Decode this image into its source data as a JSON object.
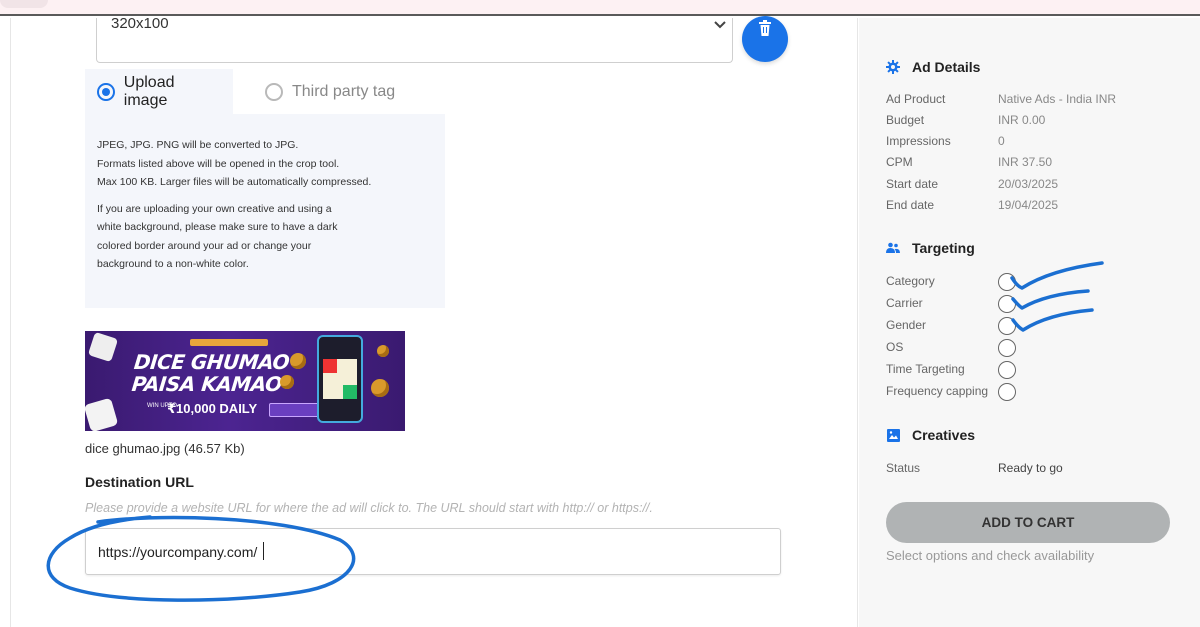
{
  "format_select": {
    "value": "320x100"
  },
  "upload_tabs": [
    {
      "label": "Upload image",
      "selected": true
    },
    {
      "label": "Third party tag",
      "selected": false
    }
  ],
  "upload_info": {
    "line1": "JPEG, JPG. PNG will be converted to JPG.",
    "line2": "Formats listed above will be opened in the crop tool.",
    "line3": "Max 100 KB. Larger files will be automatically compressed.",
    "para2_line1": "If you are uploading your own creative and using a",
    "para2_line2": "white background, please make sure to have a dark",
    "para2_line3": "colored border around your ad or change your",
    "para2_line4": "background to a non-white color."
  },
  "banner": {
    "headline_1": "DICE GHUMAO",
    "headline_2": "PAISA KAMAO",
    "win_label": "WIN UPTO",
    "prize": "₹10,000 DAILY"
  },
  "uploaded_file": {
    "caption": "dice ghumao.jpg (46.57 Kb)"
  },
  "destination": {
    "label": "Destination URL",
    "help": "Please provide a website URL for where the ad will click to. The URL should start with http:// or https://.",
    "value": "https://yourcompany.com/"
  },
  "summary": {
    "ad_details": {
      "title": "Ad Details",
      "icon": "gear-icon",
      "rows": [
        {
          "label": "Ad Product",
          "value": "Native Ads - India INR"
        },
        {
          "label": "Budget",
          "value": "INR 0.00"
        },
        {
          "label": "Impressions",
          "value": "0"
        },
        {
          "label": "CPM",
          "value": "INR 37.50"
        },
        {
          "label": "Start date",
          "value": "20/03/2025"
        },
        {
          "label": "End date",
          "value": "19/04/2025"
        }
      ]
    },
    "targeting": {
      "title": "Targeting",
      "icon": "people-icon",
      "items": [
        {
          "label": "Category"
        },
        {
          "label": "Carrier"
        },
        {
          "label": "Gender"
        },
        {
          "label": "OS"
        },
        {
          "label": "Time Targeting"
        },
        {
          "label": "Frequency capping"
        }
      ]
    },
    "creatives": {
      "title": "Creatives",
      "icon": "image-icon",
      "status_label": "Status",
      "status_value": "Ready to go"
    },
    "add_to_cart": "ADD TO CART",
    "cart_note": "Select options and check availability"
  },
  "colors": {
    "accent": "#1a73e8",
    "annotation": "#1b6fd1",
    "cart_button": "#b0b3b4"
  }
}
